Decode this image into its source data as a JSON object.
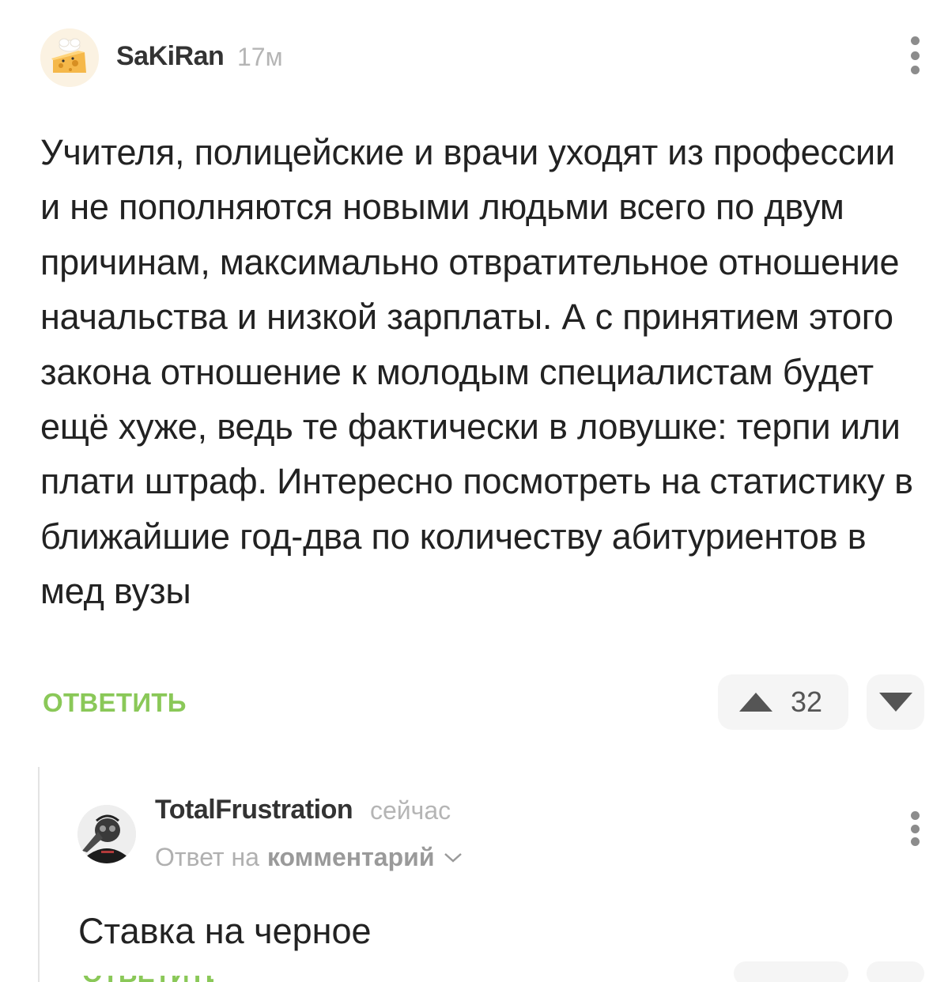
{
  "comment": {
    "author": "SaKiRan",
    "time": "17м",
    "text": "Учителя, полицейские и врачи уходят из профессии и не пополняются новыми людьми всего по двум причинам, максимально отвратительное отношение начальства и низкой зарплаты. А с принятием этого закона отношение к молодым специалистам будет ещё хуже, ведь те фактически в ловушке: терпи или плати штраф. Интересно посмотреть на статистику в ближайшие год-два по количеству абитуриентов в мед вузы",
    "reply_label": "ОТВЕТИТЬ",
    "rating": "32"
  },
  "reply": {
    "author": "TotalFrustration",
    "time": "сейчас",
    "reply_to_prefix": "Ответ на",
    "reply_to_link": "комментарий",
    "text": "Ставка на черное",
    "reply_label": "ОТВЕТИТЬ"
  },
  "colors": {
    "accent_green": "#8ac858",
    "text_primary": "#222222",
    "text_muted": "#b5b5b5",
    "vote_bg": "#f5f5f5"
  },
  "icons": {
    "more": "more-vertical-icon",
    "upvote": "upvote-triangle-icon",
    "downvote": "downvote-triangle-icon",
    "chevron": "chevron-down-icon"
  }
}
